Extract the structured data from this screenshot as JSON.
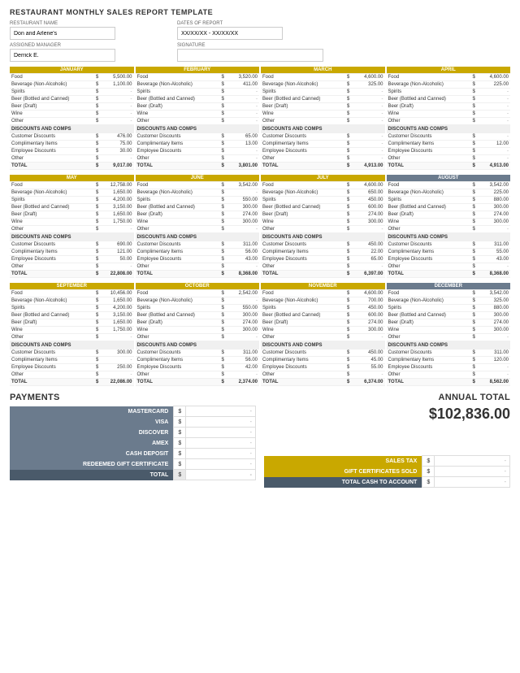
{
  "title": "RESTAURANT MONTHLY SALES REPORT TEMPLATE",
  "header": {
    "restaurant_name_label": "RESTAURANT NAME",
    "restaurant_name_value": "Don and Arlene's",
    "dates_label": "DATES OF REPORT",
    "dates_value": "XX/XX/XX - XX/XX/XX",
    "manager_label": "ASSIGNED MANAGER",
    "manager_value": "Derrick E.",
    "signature_label": "SIGNATURE",
    "signature_value": ""
  },
  "months": [
    {
      "name": "JANUARY",
      "color": "gold",
      "items": [
        {
          "label": "Food",
          "sign": "$",
          "val": "5,500.00"
        },
        {
          "label": "Beverage (Non-Alcoholic)",
          "sign": "$",
          "val": "1,100.00"
        },
        {
          "label": "Spirits",
          "sign": "$",
          "val": "-"
        },
        {
          "label": "Beer (Bottled and Canned)",
          "sign": "$",
          "val": "-"
        },
        {
          "label": "Beer (Draft)",
          "sign": "$",
          "val": "-"
        },
        {
          "label": "Wine",
          "sign": "$",
          "val": "-"
        },
        {
          "label": "Other",
          "sign": "$",
          "val": "-"
        }
      ],
      "discounts": [
        {
          "label": "Customer Discounts",
          "sign": "$",
          "val": "476.00"
        },
        {
          "label": "Complimentary Items",
          "sign": "$",
          "val": "75.00"
        },
        {
          "label": "Employee Discounts",
          "sign": "$",
          "val": "30.00"
        },
        {
          "label": "Other",
          "sign": "$",
          "val": "-"
        }
      ],
      "total": "9,017.00"
    },
    {
      "name": "FEBRUARY",
      "color": "gold",
      "items": [
        {
          "label": "Food",
          "sign": "$",
          "val": "3,520.00"
        },
        {
          "label": "Beverage (Non-Alcoholic)",
          "sign": "$",
          "val": "411.00"
        },
        {
          "label": "Spirits",
          "sign": "$",
          "val": "-"
        },
        {
          "label": "Beer (Bottled and Canned)",
          "sign": "$",
          "val": "-"
        },
        {
          "label": "Beer (Draft)",
          "sign": "$",
          "val": "-"
        },
        {
          "label": "Wine",
          "sign": "$",
          "val": "-"
        },
        {
          "label": "Other",
          "sign": "$",
          "val": "-"
        }
      ],
      "discounts": [
        {
          "label": "Customer Discounts",
          "sign": "$",
          "val": "65.00"
        },
        {
          "label": "Complimentary Items",
          "sign": "$",
          "val": "13.00"
        },
        {
          "label": "Employee Discounts",
          "sign": "$",
          "val": "-"
        },
        {
          "label": "Other",
          "sign": "$",
          "val": "-"
        }
      ],
      "total": "3,801.00"
    },
    {
      "name": "MARCH",
      "color": "gold",
      "items": [
        {
          "label": "Food",
          "sign": "$",
          "val": "4,600.00"
        },
        {
          "label": "Beverage (Non-Alcoholic)",
          "sign": "$",
          "val": "325.00"
        },
        {
          "label": "Spirits",
          "sign": "$",
          "val": "-"
        },
        {
          "label": "Beer (Bottled and Canned)",
          "sign": "$",
          "val": "-"
        },
        {
          "label": "Beer (Draft)",
          "sign": "$",
          "val": "-"
        },
        {
          "label": "Wine",
          "sign": "$",
          "val": "-"
        },
        {
          "label": "Other",
          "sign": "$",
          "val": "-"
        }
      ],
      "discounts": [
        {
          "label": "Customer Discounts",
          "sign": "$",
          "val": "-"
        },
        {
          "label": "Complimentary Items",
          "sign": "$",
          "val": "-"
        },
        {
          "label": "Employee Discounts",
          "sign": "$",
          "val": "-"
        },
        {
          "label": "Other",
          "sign": "$",
          "val": "-"
        }
      ],
      "total": "4,913.00"
    },
    {
      "name": "APRIL",
      "color": "gold",
      "items": [
        {
          "label": "Food",
          "sign": "$",
          "val": "4,600.00"
        },
        {
          "label": "Beverage (Non-Alcoholic)",
          "sign": "$",
          "val": "225.00"
        },
        {
          "label": "Spirits",
          "sign": "$",
          "val": "-"
        },
        {
          "label": "Beer (Bottled and Canned)",
          "sign": "$",
          "val": "-"
        },
        {
          "label": "Beer (Draft)",
          "sign": "$",
          "val": "-"
        },
        {
          "label": "Wine",
          "sign": "$",
          "val": "-"
        },
        {
          "label": "Other",
          "sign": "$",
          "val": "-"
        }
      ],
      "discounts": [
        {
          "label": "Customer Discounts",
          "sign": "$",
          "val": "-"
        },
        {
          "label": "Complimentary Items",
          "sign": "$",
          "val": "12.00"
        },
        {
          "label": "Employee Discounts",
          "sign": "$",
          "val": "-"
        },
        {
          "label": "Other",
          "sign": "$",
          "val": "-"
        }
      ],
      "total": "4,913.00"
    },
    {
      "name": "MAY",
      "color": "gold",
      "items": [
        {
          "label": "Food",
          "sign": "$",
          "val": "12,758.00"
        },
        {
          "label": "Beverage (Non-Alcoholic)",
          "sign": "$",
          "val": "1,650.00"
        },
        {
          "label": "Spirits",
          "sign": "$",
          "val": "4,200.00"
        },
        {
          "label": "Beer (Bottled and Canned)",
          "sign": "$",
          "val": "3,150.00"
        },
        {
          "label": "Beer (Draft)",
          "sign": "$",
          "val": "1,650.00"
        },
        {
          "label": "Wine",
          "sign": "$",
          "val": "1,750.00"
        },
        {
          "label": "Other",
          "sign": "$",
          "val": "-"
        }
      ],
      "discounts": [
        {
          "label": "Customer Discounts",
          "sign": "$",
          "val": "690.00"
        },
        {
          "label": "Complimentary Items",
          "sign": "$",
          "val": "121.00"
        },
        {
          "label": "Employee Discounts",
          "sign": "$",
          "val": "50.00"
        },
        {
          "label": "Other",
          "sign": "$",
          "val": "-"
        }
      ],
      "total": "22,808.00"
    },
    {
      "name": "JUNE",
      "color": "gold",
      "items": [
        {
          "label": "Food",
          "sign": "$",
          "val": "3,542.00"
        },
        {
          "label": "Beverage (Non-Alcoholic)",
          "sign": "$",
          "val": "-"
        },
        {
          "label": "Spirits",
          "sign": "$",
          "val": "550.00"
        },
        {
          "label": "Beer (Bottled and Canned)",
          "sign": "$",
          "val": "300.00"
        },
        {
          "label": "Beer (Draft)",
          "sign": "$",
          "val": "274.00"
        },
        {
          "label": "Wine",
          "sign": "$",
          "val": "300.00"
        },
        {
          "label": "Other",
          "sign": "$",
          "val": "-"
        }
      ],
      "discounts": [
        {
          "label": "Customer Discounts",
          "sign": "$",
          "val": "311.00"
        },
        {
          "label": "Complimentary Items",
          "sign": "$",
          "val": "56.00"
        },
        {
          "label": "Employee Discounts",
          "sign": "$",
          "val": "43.00"
        },
        {
          "label": "Other",
          "sign": "$",
          "val": "-"
        }
      ],
      "total": "8,368.00"
    },
    {
      "name": "JULY",
      "color": "gold",
      "items": [
        {
          "label": "Food",
          "sign": "$",
          "val": "4,600.00"
        },
        {
          "label": "Beverage (Non-Alcoholic)",
          "sign": "$",
          "val": "650.00"
        },
        {
          "label": "Spirits",
          "sign": "$",
          "val": "450.00"
        },
        {
          "label": "Beer (Bottled and Canned)",
          "sign": "$",
          "val": "600.00"
        },
        {
          "label": "Beer (Draft)",
          "sign": "$",
          "val": "274.00"
        },
        {
          "label": "Wine",
          "sign": "$",
          "val": "300.00"
        },
        {
          "label": "Other",
          "sign": "$",
          "val": "-"
        }
      ],
      "discounts": [
        {
          "label": "Customer Discounts",
          "sign": "$",
          "val": "450.00"
        },
        {
          "label": "Complimentary Items",
          "sign": "$",
          "val": "22.00"
        },
        {
          "label": "Employee Discounts",
          "sign": "$",
          "val": "65.00"
        },
        {
          "label": "Other",
          "sign": "$",
          "val": "-"
        }
      ],
      "total": "6,397.00"
    },
    {
      "name": "AUGUST",
      "color": "gray",
      "items": [
        {
          "label": "Food",
          "sign": "$",
          "val": "3,542.00"
        },
        {
          "label": "Beverage (Non-Alcoholic)",
          "sign": "$",
          "val": "225.00"
        },
        {
          "label": "Spirits",
          "sign": "$",
          "val": "880.00"
        },
        {
          "label": "Beer (Bottled and Canned)",
          "sign": "$",
          "val": "300.00"
        },
        {
          "label": "Beer (Draft)",
          "sign": "$",
          "val": "274.00"
        },
        {
          "label": "Wine",
          "sign": "$",
          "val": "300.00"
        },
        {
          "label": "Other",
          "sign": "$",
          "val": "-"
        }
      ],
      "discounts": [
        {
          "label": "Customer Discounts",
          "sign": "$",
          "val": "311.00"
        },
        {
          "label": "Complimentary Items",
          "sign": "$",
          "val": "55.00"
        },
        {
          "label": "Employee Discounts",
          "sign": "$",
          "val": "43.00"
        },
        {
          "label": "Other",
          "sign": "$",
          "val": "-"
        }
      ],
      "total": "8,368.00"
    },
    {
      "name": "SEPTEMBER",
      "color": "gold",
      "items": [
        {
          "label": "Food",
          "sign": "$",
          "val": "10,456.00"
        },
        {
          "label": "Beverage (Non-Alcoholic)",
          "sign": "$",
          "val": "1,650.00"
        },
        {
          "label": "Spirits",
          "sign": "$",
          "val": "4,200.00"
        },
        {
          "label": "Beer (Bottled and Canned)",
          "sign": "$",
          "val": "3,150.00"
        },
        {
          "label": "Beer (Draft)",
          "sign": "$",
          "val": "1,650.00"
        },
        {
          "label": "Wine",
          "sign": "$",
          "val": "1,750.00"
        },
        {
          "label": "Other",
          "sign": "$",
          "val": "-"
        }
      ],
      "discounts": [
        {
          "label": "Customer Discounts",
          "sign": "$",
          "val": "300.00"
        },
        {
          "label": "Complimentary Items",
          "sign": "$",
          "val": "-"
        },
        {
          "label": "Employee Discounts",
          "sign": "$",
          "val": "250.00"
        },
        {
          "label": "Other",
          "sign": "$",
          "val": "-"
        }
      ],
      "total": "22,086.00"
    },
    {
      "name": "OCTOBER",
      "color": "gold",
      "items": [
        {
          "label": "Food",
          "sign": "$",
          "val": "2,542.00"
        },
        {
          "label": "Beverage (Non-Alcoholic)",
          "sign": "$",
          "val": "-"
        },
        {
          "label": "Spirits",
          "sign": "$",
          "val": "550.00"
        },
        {
          "label": "Beer (Bottled and Canned)",
          "sign": "$",
          "val": "300.00"
        },
        {
          "label": "Beer (Draft)",
          "sign": "$",
          "val": "274.00"
        },
        {
          "label": "Wine",
          "sign": "$",
          "val": "300.00"
        },
        {
          "label": "Other",
          "sign": "$",
          "val": "-"
        }
      ],
      "discounts": [
        {
          "label": "Customer Discounts",
          "sign": "$",
          "val": "311.00"
        },
        {
          "label": "Complimentary Items",
          "sign": "$",
          "val": "56.00"
        },
        {
          "label": "Employee Discounts",
          "sign": "$",
          "val": "42.00"
        },
        {
          "label": "Other",
          "sign": "$",
          "val": "-"
        }
      ],
      "total": "2,374.00"
    },
    {
      "name": "NOVEMBER",
      "color": "gold",
      "items": [
        {
          "label": "Food",
          "sign": "$",
          "val": "4,600.00"
        },
        {
          "label": "Beverage (Non-Alcoholic)",
          "sign": "$",
          "val": "700.00"
        },
        {
          "label": "Spirits",
          "sign": "$",
          "val": "450.00"
        },
        {
          "label": "Beer (Bottled and Canned)",
          "sign": "$",
          "val": "600.00"
        },
        {
          "label": "Beer (Draft)",
          "sign": "$",
          "val": "274.00"
        },
        {
          "label": "Wine",
          "sign": "$",
          "val": "300.00"
        },
        {
          "label": "Other",
          "sign": "$",
          "val": "-"
        }
      ],
      "discounts": [
        {
          "label": "Customer Discounts",
          "sign": "$",
          "val": "450.00"
        },
        {
          "label": "Complimentary Items",
          "sign": "$",
          "val": "45.00"
        },
        {
          "label": "Employee Discounts",
          "sign": "$",
          "val": "55.00"
        },
        {
          "label": "Other",
          "sign": "$",
          "val": "-"
        }
      ],
      "total": "6,374.00"
    },
    {
      "name": "DECEMBER",
      "color": "gray",
      "items": [
        {
          "label": "Food",
          "sign": "$",
          "val": "3,542.00"
        },
        {
          "label": "Beverage (Non-Alcoholic)",
          "sign": "$",
          "val": "325.00"
        },
        {
          "label": "Spirits",
          "sign": "$",
          "val": "880.00"
        },
        {
          "label": "Beer (Bottled and Canned)",
          "sign": "$",
          "val": "300.00"
        },
        {
          "label": "Beer (Draft)",
          "sign": "$",
          "val": "274.00"
        },
        {
          "label": "Wine",
          "sign": "$",
          "val": "300.00"
        },
        {
          "label": "Other",
          "sign": "$",
          "val": "-"
        }
      ],
      "discounts": [
        {
          "label": "Customer Discounts",
          "sign": "$",
          "val": "311.00"
        },
        {
          "label": "Complimentary Items",
          "sign": "$",
          "val": "120.00"
        },
        {
          "label": "Employee Discounts",
          "sign": "$",
          "val": "-"
        },
        {
          "label": "Other",
          "sign": "$",
          "val": "-"
        }
      ],
      "total": "8,562.00"
    }
  ],
  "payments": {
    "title": "PAYMENTS",
    "items": [
      {
        "label": "MASTERCARD",
        "sign": "$",
        "val": "-"
      },
      {
        "label": "VISA",
        "sign": "$",
        "val": "-"
      },
      {
        "label": "DISCOVER",
        "sign": "$",
        "val": "-"
      },
      {
        "label": "AMEX",
        "sign": "$",
        "val": "-"
      },
      {
        "label": "CASH DEPOSIT",
        "sign": "$",
        "val": "-"
      },
      {
        "label": "REDEEMED GIFT CERTIFICATE",
        "sign": "$",
        "val": "-"
      }
    ],
    "total_label": "TOTAL",
    "total_sign": "$",
    "total_val": "-"
  },
  "annual": {
    "title": "ANNUAL TOTAL",
    "value": "$102,836.00",
    "items": [
      {
        "label": "SALES TAX",
        "sign": "$",
        "val": "-",
        "color": "gold"
      },
      {
        "label": "GIFT CERTIFICATES SOLD",
        "sign": "$",
        "val": "-",
        "color": "gold"
      },
      {
        "label": "TOTAL CASH TO ACCOUNT",
        "sign": "$",
        "val": "-",
        "color": "dark"
      }
    ]
  },
  "labels": {
    "discounts_comps": "DISCOUNTS AND COMPS",
    "total": "TOTAL"
  }
}
